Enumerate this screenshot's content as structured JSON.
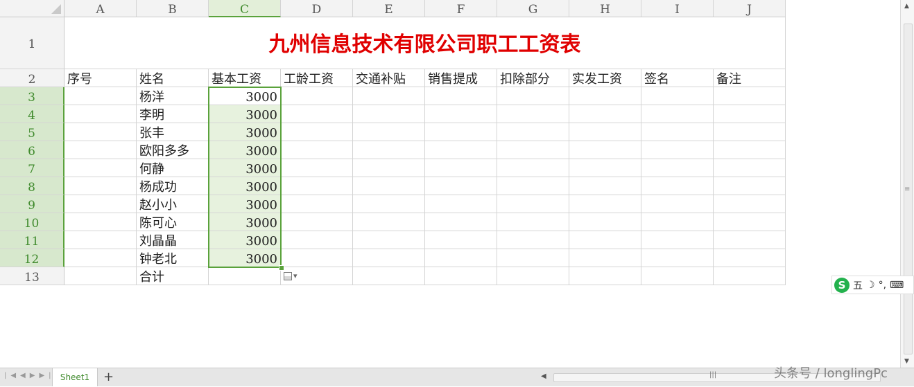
{
  "columns": [
    "A",
    "B",
    "C",
    "D",
    "E",
    "F",
    "G",
    "H",
    "I",
    "J"
  ],
  "selected_column": "C",
  "row_numbers": [
    "1",
    "2",
    "3",
    "4",
    "5",
    "6",
    "7",
    "8",
    "9",
    "10",
    "11",
    "12",
    "13"
  ],
  "title": "九州信息技术有限公司职工工资表",
  "headers": [
    "序号",
    "姓名",
    "基本工资",
    "工龄工资",
    "交通补贴",
    "销售提成",
    "扣除部分",
    "实发工资",
    "签名",
    "备注"
  ],
  "employees": [
    {
      "name": "杨洋",
      "base": "3000"
    },
    {
      "name": "李明",
      "base": "3000"
    },
    {
      "name": "张丰",
      "base": "3000"
    },
    {
      "name": "欧阳多多",
      "base": "3000"
    },
    {
      "name": "何静",
      "base": "3000"
    },
    {
      "name": "杨成功",
      "base": "3000"
    },
    {
      "name": "赵小小",
      "base": "3000"
    },
    {
      "name": "陈可心",
      "base": "3000"
    },
    {
      "name": "刘晶晶",
      "base": "3000"
    },
    {
      "name": "钟老北",
      "base": "3000"
    }
  ],
  "total_label": "合计",
  "sheet_tab": "Sheet1",
  "ime": {
    "logo": "S",
    "mode": "五"
  },
  "watermark": "头条号 / longlingPc",
  "colors": {
    "title": "#e00000",
    "selection": "#5aa23b",
    "sheet_tab_text": "#3f8a2c"
  }
}
